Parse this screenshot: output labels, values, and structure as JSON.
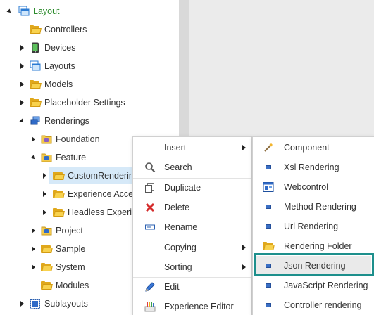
{
  "tree": {
    "items": [
      {
        "label": "Layout"
      },
      {
        "label": "Controllers"
      },
      {
        "label": "Devices"
      },
      {
        "label": "Layouts"
      },
      {
        "label": "Models"
      },
      {
        "label": "Placeholder Settings"
      },
      {
        "label": "Renderings"
      },
      {
        "label": "Foundation"
      },
      {
        "label": "Feature"
      },
      {
        "label": "CustomRenderings"
      },
      {
        "label": "Experience Accelerator"
      },
      {
        "label": "Headless Experience"
      },
      {
        "label": "Project"
      },
      {
        "label": "Sample"
      },
      {
        "label": "System"
      },
      {
        "label": "Modules"
      },
      {
        "label": "Sublayouts"
      }
    ]
  },
  "context_menu": {
    "items": [
      {
        "label": "Insert"
      },
      {
        "label": "Search"
      },
      {
        "label": "Duplicate"
      },
      {
        "label": "Delete"
      },
      {
        "label": "Rename"
      },
      {
        "label": "Copying"
      },
      {
        "label": "Sorting"
      },
      {
        "label": "Edit"
      },
      {
        "label": "Experience Editor"
      }
    ]
  },
  "insert_submenu": {
    "items": [
      {
        "label": "Component"
      },
      {
        "label": "Xsl Rendering"
      },
      {
        "label": "Webcontrol"
      },
      {
        "label": "Method Rendering"
      },
      {
        "label": "Url Rendering"
      },
      {
        "label": "Rendering Folder"
      },
      {
        "label": "Json Rendering"
      },
      {
        "label": "JavaScript Rendering"
      },
      {
        "label": "Controller rendering"
      }
    ],
    "highlighted": "Json Rendering"
  },
  "colors": {
    "root_label": "#2a8a2a",
    "selection": "#d6e9f8",
    "highlight_border": "#1d8f8c",
    "splitter": "#d9d9d9",
    "content_bg": "#ebebeb"
  }
}
